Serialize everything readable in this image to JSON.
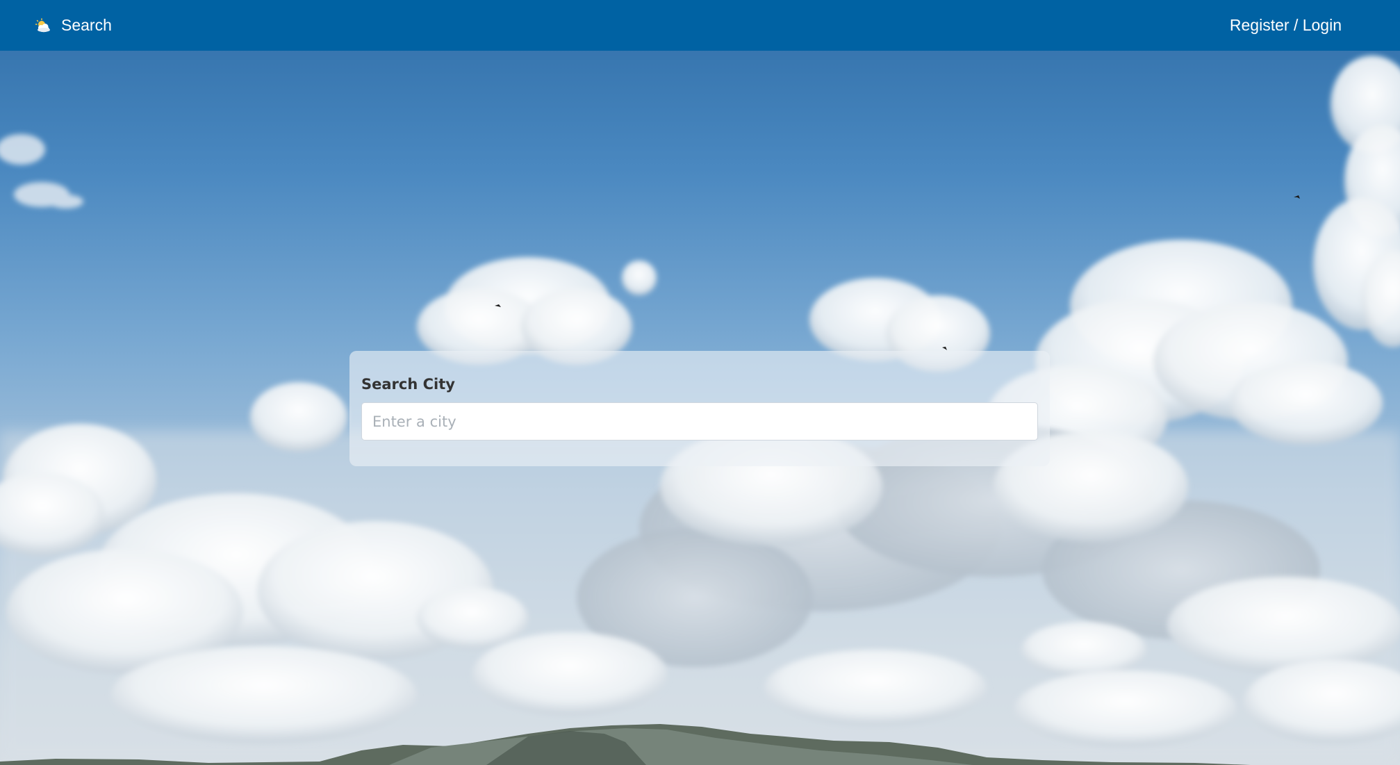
{
  "navbar": {
    "brand_label": "Search",
    "brand_icon": "partly-cloudy-icon",
    "auth_link": "Register / Login",
    "background_color": "#0062a3"
  },
  "search": {
    "title": "Search City",
    "placeholder": "Enter a city",
    "value": ""
  },
  "background": {
    "description_icon": "sky-clouds-mountains-image"
  }
}
